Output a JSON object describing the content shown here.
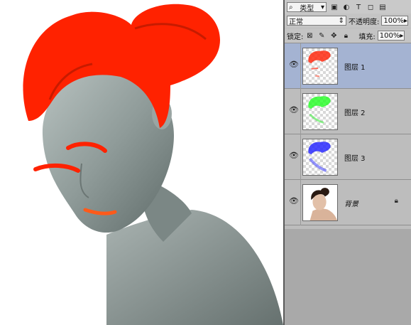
{
  "colors": {
    "hair_red": "#ff2200",
    "skin_gray": "#8f9b99",
    "selected_layer": "#a4b3d2",
    "panel_bg": "#bdbdbd"
  },
  "panel": {
    "kind_label": "类型",
    "blend_mode": "正常",
    "opacity_label": "不透明度:",
    "opacity_value": "100%",
    "lock_label": "锁定:",
    "fill_label": "填充:",
    "fill_value": "100%"
  },
  "layers": [
    {
      "name": "图层 1",
      "selected": true,
      "tint": "red",
      "locked": false
    },
    {
      "name": "图层 2",
      "selected": false,
      "tint": "green",
      "locked": false
    },
    {
      "name": "图层 3",
      "selected": false,
      "tint": "blue",
      "locked": false
    },
    {
      "name": "背景",
      "selected": false,
      "tint": "photo",
      "locked": true
    }
  ],
  "icons": {
    "search": "search-icon",
    "eye": "eye-icon",
    "lock": "lock-icon"
  }
}
